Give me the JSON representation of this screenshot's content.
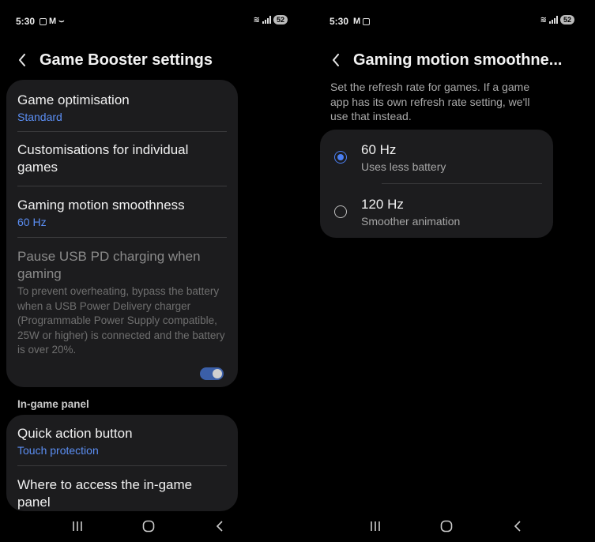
{
  "left": {
    "status": {
      "time": "5:30",
      "battery": "52"
    },
    "header": {
      "title": "Game Booster settings"
    },
    "items": [
      {
        "label": "Game optimisation",
        "value": "Standard"
      },
      {
        "label": "Customisations for individual games"
      },
      {
        "label": "Gaming motion smoothness",
        "value": "60 Hz"
      },
      {
        "label": "Pause USB PD charging when gaming",
        "desc": "To prevent overheating, bypass the battery when a USB Power Delivery charger (Programmable Power Supply compatible, 25W or higher) is connected and the battery is over 20%."
      }
    ],
    "section_label": "In-game panel",
    "panel_items": [
      {
        "label": "Quick action button",
        "value": "Touch protection"
      },
      {
        "label": "Where to access the in-game panel"
      }
    ]
  },
  "right": {
    "status": {
      "time": "5:30",
      "battery": "52"
    },
    "header": {
      "title": "Gaming motion smoothne..."
    },
    "description": "Set the refresh rate for games. If a game app has its own refresh rate setting, we'll use that instead.",
    "options": [
      {
        "label": "60 Hz",
        "sub": "Uses less battery",
        "selected": true
      },
      {
        "label": "120 Hz",
        "sub": "Smoother animation",
        "selected": false
      }
    ]
  },
  "colors": {
    "accent": "#5b8ef3",
    "card": "#1c1c1e",
    "background": "#000000"
  }
}
